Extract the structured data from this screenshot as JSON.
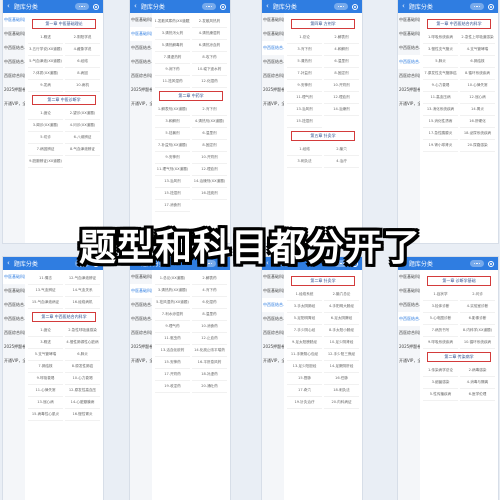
{
  "overlay_text": "题型和科目都分开了",
  "colors": {
    "header": "#2f7de1",
    "chapter_border": "#d33b3b"
  },
  "panels": [
    {
      "title": "题库分类",
      "sidebar": [
        "中医基础科目1",
        "中医基础科目2",
        "中西医结合..",
        "中西医结合..",
        "西医综合科目",
        "2025押题卷",
        "开通VIP，全..."
      ],
      "active": 0,
      "sections": [
        {
          "chapter": "第一章 中医基础理论",
          "items": [
            "1.概述",
            "2.阴阳学说",
            "3.五行学说(XX道题)",
            "4.藏象学说",
            "5.气血津液(XX道题)",
            "6.经络",
            "7.体质(XX道题)",
            "8.病因",
            "9.发病",
            "10.病机"
          ]
        },
        {
          "chapter": "第二章 中医诊断学",
          "items": [
            "1.绪论",
            "2.望诊(XX道题)",
            "3.闻诊(XX道题)",
            "4.问诊(XX道题)",
            "5.切诊",
            "6.八纲辨证",
            "7.病因辨证",
            "8.气血津液辨证",
            "9.脏腑辨证(XX道题)"
          ]
        }
      ]
    },
    {
      "title": "题库分类",
      "sidebar": [
        "中医基础科目1",
        "中医基础科目2",
        "中西医结合..",
        "中西医结合..",
        "西医综合科目",
        "2025押题卷",
        "开通VIP，全..."
      ],
      "active": 1,
      "sections": [
        {
          "chapter": "",
          "items": [
            "1.发散风寒药(XX道题)",
            "2.发散风热药",
            "3.清热泻火药",
            "4.清热燥湿药",
            "5.清热解毒药",
            "6.清热凉血药",
            "7.清虚热药",
            "8.攻下药",
            "9.润下药",
            "10.峻下逐水药",
            "11.祛风湿药",
            "12.化湿药"
          ]
        },
        {
          "chapter": "第二章 中药学",
          "items": [
            "1.解表剂(XX道题)",
            "2.泻下剂",
            "3.和解剂",
            "4.清热剂(XX道题)",
            "5.祛暑剂",
            "6.温里剂",
            "7.补益剂(XX道题)",
            "8.固涩剂",
            "9.安神剂",
            "10.开窍剂",
            "11.理气剂(XX道题)",
            "12.理血剂",
            "13.治风剂",
            "14.治燥剂(XX道题)",
            "15.祛湿剂",
            "16.祛痰剂",
            "17.消食剂"
          ]
        }
      ]
    },
    {
      "title": "题库分类",
      "sidebar": [
        "中医基础科目1",
        "中医基础科目2",
        "中西医结合..",
        "中西医结合..",
        "西医综合科目",
        "2025押题卷",
        "开通VIP，全..."
      ],
      "active": 2,
      "sections": [
        {
          "chapter": "第四章 方剂学",
          "items": [
            "1.总论",
            "2.解表剂",
            "3.泻下剂",
            "4.和解剂",
            "5.清热剂",
            "6.温里剂",
            "7.补益剂",
            "8.固涩剂",
            "9.安神剂",
            "10.开窍剂",
            "11.理气剂",
            "12.理血剂",
            "13.治风剂",
            "14.治燥剂",
            "15.祛湿剂"
          ]
        },
        {
          "chapter": "第五章 针灸学",
          "items": [
            "1.经络",
            "2.腧穴",
            "3.刺灸法",
            "4.治疗"
          ]
        }
      ]
    },
    {
      "title": "题库分类",
      "sidebar": [
        "中医基础科目1",
        "中医基础科目2",
        "中西医结合..",
        "中西医结合..",
        "西医综合科目",
        "2025押题卷",
        "开通VIP，全..."
      ],
      "active": 3,
      "sections": [
        {
          "chapter": "第一章 中西医结合内科学",
          "items": [
            "1.呼吸系统疾病",
            "2.急性上呼吸道感染",
            "3.慢性支气管炎",
            "4.支气管哮喘",
            "5.肺炎",
            "6.肺结核",
            "7.原发性支气管肺癌",
            "8.循环系统疾病",
            "9.心力衰竭",
            "10.心律失常",
            "11.高血压病",
            "12.冠心病",
            "13.消化系统疾病",
            "14.胃炎",
            "15.消化性溃疡",
            "16.肝硬化",
            "17.急性胰腺炎",
            "18.泌尿系统疾病",
            "19.肾小球肾炎",
            "20.尿路感染"
          ]
        }
      ]
    },
    {
      "title": "题库分类",
      "sidebar": [
        "中医基础科目1",
        "中医基础科目2",
        "中西医结合..",
        "中西医结合..",
        "西医综合科目",
        "2025押题卷",
        "开通VIP，全..."
      ],
      "active": 0,
      "sections": [
        {
          "chapter": "",
          "items": [
            "11.情志",
            "12.气血津液辨证",
            "13.气血辨证",
            "14.气血关系",
            "15.气血津液病证",
            "16.经络病机"
          ]
        },
        {
          "chapter": "第二章 中西医结合内科学",
          "items": [
            "1.绪论",
            "2.急性呼吸道感染",
            "3.概述",
            "4.慢性肺源性心脏病",
            "5.支气管哮喘",
            "6.肺炎",
            "7.肺结核",
            "8.原发性肺癌",
            "9.呼吸衰竭",
            "10.心力衰竭",
            "11.心律失常",
            "12.原发性高血压",
            "13.冠心病",
            "14.心脏瓣膜病",
            "15.病毒性心肌炎",
            "16.慢性胃炎"
          ]
        }
      ]
    },
    {
      "title": "题库分类",
      "sidebar": [
        "中医基础科目1",
        "中医基础科目2",
        "中西医结合..",
        "中西医结合..",
        "西医综合科目",
        "2025押题卷",
        "开通VIP，全..."
      ],
      "active": 1,
      "sections": [
        {
          "chapter": "",
          "items": [
            "1.总论(XX道题)",
            "2.解表药",
            "3.清热药(XX道题)",
            "4.泻下药",
            "5.祛风湿药(XX道题)",
            "6.化湿药",
            "7.利水渗湿药",
            "8.温里药",
            "9.理气药",
            "10.消食药",
            "11.驱虫药",
            "12.止血药",
            "13.活血化瘀药",
            "14.化痰止咳平喘药",
            "15.安神药",
            "16.平肝息风药",
            "17.开窍药",
            "18.补虚药",
            "19.收涩药",
            "20.涌吐药"
          ]
        }
      ]
    },
    {
      "title": "题库分类",
      "sidebar": [
        "中医基础科目1",
        "中医基础科目2",
        "中西医结合..",
        "中西医结合..",
        "西医综合科目",
        "2025押题卷",
        "开通VIP，全..."
      ],
      "active": 2,
      "sections": [
        {
          "chapter": "第二章 针灸学",
          "items": [
            "1.经络系统",
            "2.腧穴总论",
            "3.手太阴肺经",
            "4.手阳明大肠经",
            "5.足阳明胃经",
            "6.足太阴脾经",
            "7.手少阴心经",
            "8.手太阳小肠经",
            "9.足太阳膀胱经",
            "10.足少阴肾经",
            "11.手厥阴心包经",
            "12.手少阳三焦经",
            "13.足少阳胆经",
            "14.足厥阴肝经",
            "15.督脉",
            "16.任脉",
            "17.奇穴",
            "18.刺灸法",
            "19.针灸治疗",
            "20.内科病证"
          ]
        }
      ]
    },
    {
      "title": "题库分类",
      "sidebar": [
        "中医基础科目1",
        "中医基础科目2",
        "中西医结合..",
        "中西医结合..",
        "西医综合科目",
        "2025押题卷",
        "开通VIP，全..."
      ],
      "active": 3,
      "sections": [
        {
          "chapter": "第一章 诊断学基础",
          "items": [
            "1.症状学",
            "2.问诊",
            "3.检体诊断",
            "4.实验室诊断",
            "5.心电图诊断",
            "6.影像诊断",
            "7.病历书写",
            "8.内科学(XX道题)",
            "9.呼吸系统疾病",
            "10.循环系统疾病"
          ]
        },
        {
          "chapter": "第二章 传染病学",
          "items": [
            "1.传染病学总论",
            "2.病毒感染",
            "3.细菌感染",
            "4.消毒与隔离",
            "5.性传播疾病",
            "6.医学伦理"
          ]
        }
      ]
    }
  ]
}
